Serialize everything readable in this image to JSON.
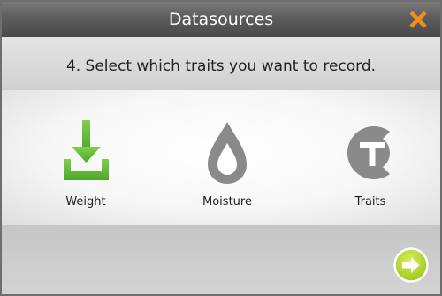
{
  "window": {
    "title": "Datasources"
  },
  "instruction": "4. Select which traits you want to record.",
  "traits": [
    {
      "label": "Weight",
      "icon": "download-weight-icon",
      "color": "#66c23a"
    },
    {
      "label": "Moisture",
      "icon": "droplet-icon",
      "color": "#8a8a8a"
    },
    {
      "label": "Traits",
      "icon": "ct-logo-icon",
      "color": "#8a8a8a"
    }
  ],
  "colors": {
    "close": "#f28c1c",
    "next": "#b8d92a",
    "weight_green": "#66c23a",
    "icon_gray": "#8a8a8a"
  }
}
